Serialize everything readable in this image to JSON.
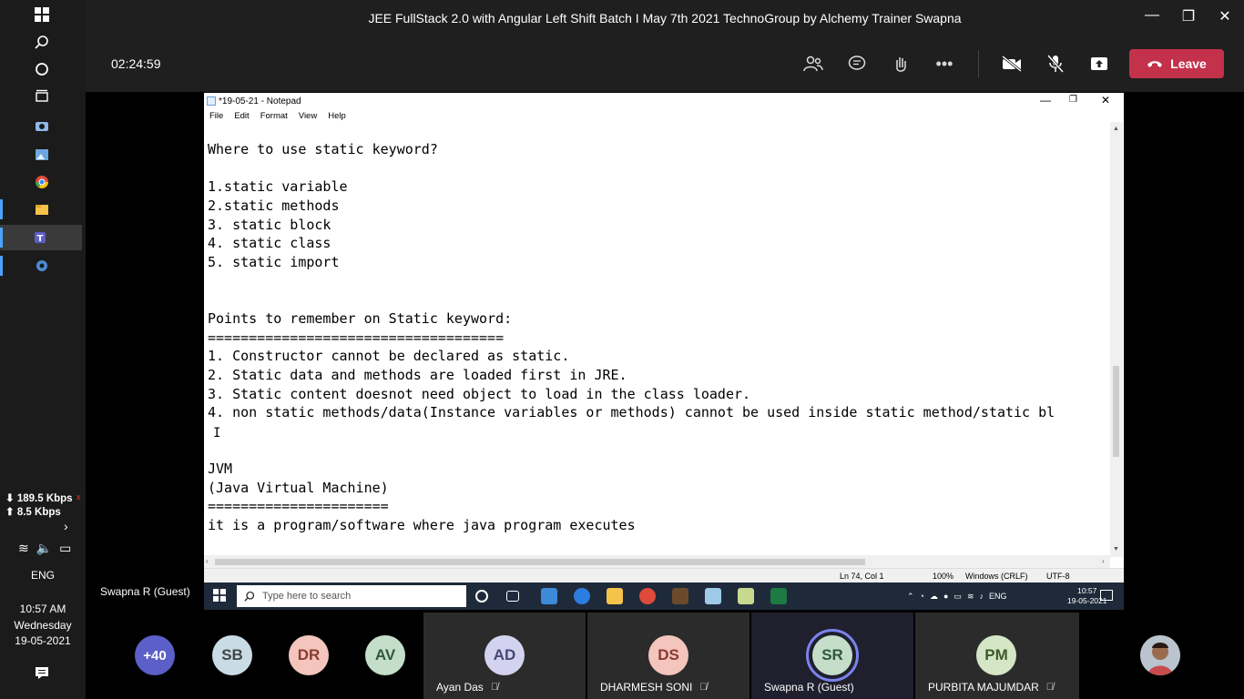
{
  "window": {
    "title": "JEE FullStack 2.0 with Angular Left Shift Batch I May 7th 2021 TechnoGroup by Alchemy Trainer Swapna"
  },
  "meeting": {
    "timer": "02:24:59",
    "leave_label": "Leave",
    "presenter": "Swapna R (Guest)"
  },
  "os_side": {
    "net_down": "189.5 Kbps",
    "net_up": "8.5 Kbps",
    "lang": "ENG",
    "time": "10:57 AM",
    "day": "Wednesday",
    "date": "19-05-2021"
  },
  "notepad": {
    "title": "*19-05-21 - Notepad",
    "menu": [
      "File",
      "Edit",
      "Format",
      "View",
      "Help"
    ],
    "lines": [
      "Where to use static keyword?",
      "",
      "1.static variable",
      "2.static methods",
      "3. static block",
      "4. static class",
      "5. static import",
      "",
      "",
      "Points to remember on Static keyword:",
      "====================================",
      "1. Constructor cannot be declared as static.",
      "2. Static data and methods are loaded first in JRE.",
      "3. Static content doesnot need object to load in the class loader.",
      "4. non static methods/data(Instance variables or methods) cannot be used inside static method/static bl",
      "",
      "",
      "JVM",
      "(Java Virtual Machine)",
      "======================",
      "it is a program/software where java program executes"
    ],
    "status_pos": "Ln 74, Col 1",
    "status_zoom": "100%",
    "status_eol": "Windows (CRLF)",
    "status_enc": "UTF-8"
  },
  "shared_taskbar": {
    "search_placeholder": "Type here to search",
    "lang": "ENG",
    "time": "10:57",
    "date": "19-05-2021"
  },
  "participants": {
    "overflow": "+40",
    "small": [
      {
        "initials": "SB",
        "color": "#c9dce6"
      },
      {
        "initials": "DR",
        "color": "#f3c5bd"
      },
      {
        "initials": "AV",
        "color": "#c5dec9"
      }
    ],
    "tiles": [
      {
        "initials": "AD",
        "name": "Ayan Das",
        "color": "#d3d3f0"
      },
      {
        "initials": "DS",
        "name": "DHARMESH SONI",
        "color": "#f3c5bd"
      },
      {
        "initials": "SR",
        "name": "Swapna R (Guest)",
        "color": "#c5dec9"
      },
      {
        "initials": "PM",
        "name": "PURBITA MAJUMDAR",
        "color": "#d4e6c6"
      }
    ]
  },
  "colors": {
    "leave": "#c4314b",
    "speaking_ring": "#7b83eb",
    "overflow_bg": "#5b5fc7"
  }
}
